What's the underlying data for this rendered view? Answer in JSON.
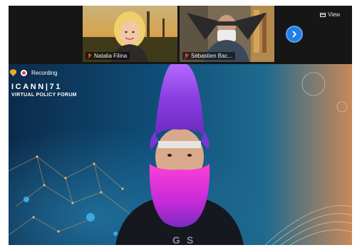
{
  "participants": [
    {
      "name": "Natalia Filina",
      "muted": true
    },
    {
      "name": "Sébastien Bac...",
      "muted": true
    }
  ],
  "controls": {
    "view_label": "View",
    "next_page_icon": "chevron-right-icon"
  },
  "recording": {
    "label": "Recording",
    "indicator_color": "#e23b3b"
  },
  "background": {
    "logo_line1": "ICANN|71",
    "logo_line2": "VIRTUAL POLICY FORUM"
  },
  "colors": {
    "accent": "#1f7ee8",
    "muted_mic": "#e2403a",
    "security_shield": "#f0a623"
  }
}
